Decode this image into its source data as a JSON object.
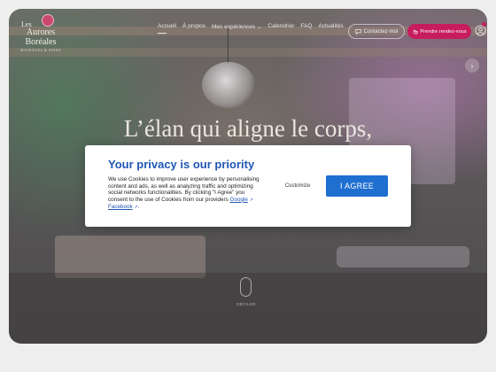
{
  "brand": {
    "logo_line1": "Les",
    "logo_line2": "Aurores",
    "logo_line3": "Boréales",
    "logo_line4": "MASSAGES & SOINS"
  },
  "nav": {
    "items": [
      {
        "label": "Accueil",
        "active": true
      },
      {
        "label": "À propos",
        "active": false
      },
      {
        "label": "Mes expériences",
        "active": false,
        "has_dropdown": true
      },
      {
        "label": "Calendrier",
        "active": false
      },
      {
        "label": "FAQ",
        "active": false
      },
      {
        "label": "Actualités",
        "active": false
      }
    ],
    "contact_label": "Contactez-moi",
    "reserve_label": "Prendre rendez-vous",
    "accent_color": "#c71d5d"
  },
  "hero": {
    "headline": "L’élan qui aligne le corps,",
    "scroll_label": "DÉFILER"
  },
  "cookie_dialog": {
    "title": "Your privacy is our priority",
    "body": "We use Cookies to improve user experience by personalising content and ads, as well as analyzing traffic and optimizing social networks functionalities. By clicking \"I Agree\" you consent to the use of Cookies from our providers",
    "link_google": "Google",
    "link_facebook": "Facebook",
    "customize_label": "Customize",
    "agree_label": "I AGREE",
    "title_color": "#1f56b4",
    "button_color": "#1f6fd1"
  }
}
